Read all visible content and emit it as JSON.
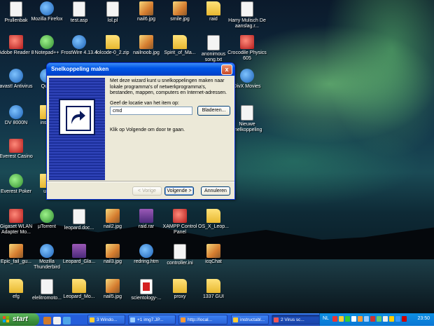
{
  "desktop": {
    "icons": [
      {
        "label": "Prullenbak",
        "kind": "doc",
        "icon": "recycle-bin-icon"
      },
      {
        "label": "Mozilla Firefox",
        "kind": "app",
        "icon": "firefox-icon"
      },
      {
        "label": "test.asp",
        "kind": "doc",
        "icon": "asp-file-icon"
      },
      {
        "label": "lol.pl",
        "kind": "doc",
        "icon": "perl-file-icon"
      },
      {
        "label": "nail6.jpg",
        "kind": "img",
        "icon": "jpg-file-icon"
      },
      {
        "label": "smile.jpg",
        "kind": "img",
        "icon": "jpg-file-icon"
      },
      {
        "label": "raid",
        "kind": "folder",
        "icon": "folder-icon"
      },
      {
        "label": "Harry Mulisch De aanslag.r...",
        "kind": "doc",
        "icon": "document-icon"
      },
      {
        "label": "Adobe Reader 8",
        "kind": "red",
        "icon": "adobe-reader-icon"
      },
      {
        "label": "Notepad++",
        "kind": "green",
        "icon": "notepad-plus-plus-icon"
      },
      {
        "label": "FrostWire 4.13.4",
        "kind": "app",
        "icon": "frostwire-icon"
      },
      {
        "label": "lolcode-0_2.zip",
        "kind": "folder",
        "icon": "zip-file-icon"
      },
      {
        "label": "nailnoob.jpg",
        "kind": "img",
        "icon": "jpg-file-icon"
      },
      {
        "label": "Spirit_of_Ma...",
        "kind": "folder",
        "icon": "folder-icon"
      },
      {
        "label": "anonimous song.txt",
        "kind": "doc",
        "icon": "text-file-icon"
      },
      {
        "label": "Crocodile Physics 605",
        "kind": "red",
        "icon": "crocodile-physics-icon"
      },
      {
        "label": "avast! Antivirus",
        "kind": "app",
        "icon": "avast-icon"
      },
      {
        "label": "Qui...",
        "kind": "app",
        "icon": "app-icon"
      },
      {
        "label": "DivX Movies",
        "kind": "app",
        "icon": "divx-icon"
      },
      {
        "label": "DV 8000N",
        "kind": "app",
        "icon": "dv-icon"
      },
      {
        "label": "insu...",
        "kind": "folder",
        "icon": "folder-icon"
      },
      {
        "label": "Nieuwe snelkoppeling",
        "kind": "doc",
        "icon": "shortcut-icon"
      },
      {
        "label": "Everest Casino",
        "kind": "red",
        "icon": "casino-icon"
      },
      {
        "label": "Everest Poker",
        "kind": "green",
        "icon": "poker-icon"
      },
      {
        "label": "u...",
        "kind": "folder",
        "icon": "folder-icon"
      },
      {
        "label": "Gigaset WLAN Adapter Mo...",
        "kind": "red",
        "icon": "wlan-adapter-icon"
      },
      {
        "label": "µTorrent",
        "kind": "green",
        "icon": "utorrent-icon"
      },
      {
        "label": "leopard.doc...",
        "kind": "doc",
        "icon": "word-doc-icon"
      },
      {
        "label": "nail2.jpg",
        "kind": "img",
        "icon": "jpg-file-icon"
      },
      {
        "label": "raid.rar",
        "kind": "rar",
        "icon": "rar-file-icon"
      },
      {
        "label": "XAMPP Control Panel",
        "kind": "red",
        "icon": "xampp-icon"
      },
      {
        "label": "OS_X_Leop...",
        "kind": "folder",
        "icon": "folder-icon"
      },
      {
        "label": "Epic_fail_gu...",
        "kind": "img",
        "icon": "jpg-file-icon"
      },
      {
        "label": "Mozilla Thunderbird",
        "kind": "app",
        "icon": "thunderbird-icon"
      },
      {
        "label": "Leopard_Gla...",
        "kind": "rar",
        "icon": "rar-file-icon"
      },
      {
        "label": "nail3.jpg",
        "kind": "img",
        "icon": "jpg-file-icon"
      },
      {
        "label": "redring.htm",
        "kind": "app",
        "icon": "html-file-icon"
      },
      {
        "label": "controller.ini",
        "kind": "doc",
        "icon": "ini-file-icon"
      },
      {
        "label": "icqChat",
        "kind": "img",
        "icon": "icq-icon"
      },
      {
        "label": "efg",
        "kind": "folder",
        "icon": "folder-icon"
      },
      {
        "label": "elelitromoto...",
        "kind": "doc",
        "icon": "document-icon"
      },
      {
        "label": "Leopard_Mo...",
        "kind": "folder",
        "icon": "folder-icon"
      },
      {
        "label": "nail5.jpg",
        "kind": "img",
        "icon": "jpg-file-icon"
      },
      {
        "label": "scientology-...",
        "kind": "pdf",
        "icon": "pdf-file-icon"
      },
      {
        "label": "proxy",
        "kind": "folder",
        "icon": "folder-icon"
      },
      {
        "label": "1337 GUI",
        "kind": "folder",
        "icon": "folder-icon"
      }
    ]
  },
  "dialog": {
    "title": "Snelkoppeling maken",
    "close_label": "x",
    "description": "Met deze wizard kunt u snelkoppelingen maken naar lokale programma's of netwerkprogramma's, bestanden, mappen, computers en Internet-adressen.",
    "prompt": "Geef de locatie van het item op:",
    "location_value": "cmd",
    "browse_label": "Bladeren...",
    "hint": "Klik op Volgende om door te gaan.",
    "back_label": "< Vorige",
    "next_label": "Volgende >",
    "cancel_label": "Annuleren"
  },
  "taskbar": {
    "start_label": "start",
    "buttons": [
      {
        "label": "3 Windo...",
        "active": false
      },
      {
        "label": "+1 img7.JP...",
        "active": false
      },
      {
        "label": "http://local...",
        "active": false
      },
      {
        "label": "instructabl...",
        "active": false
      },
      {
        "label": "2 Virus sc...",
        "active": true
      }
    ],
    "language": "NL",
    "clock": "23:50"
  },
  "colors": {
    "title_bar": "#0055e5",
    "taskbar": "#245edb",
    "start_button": "#3c8f3c",
    "tray": "#0b77d4"
  }
}
